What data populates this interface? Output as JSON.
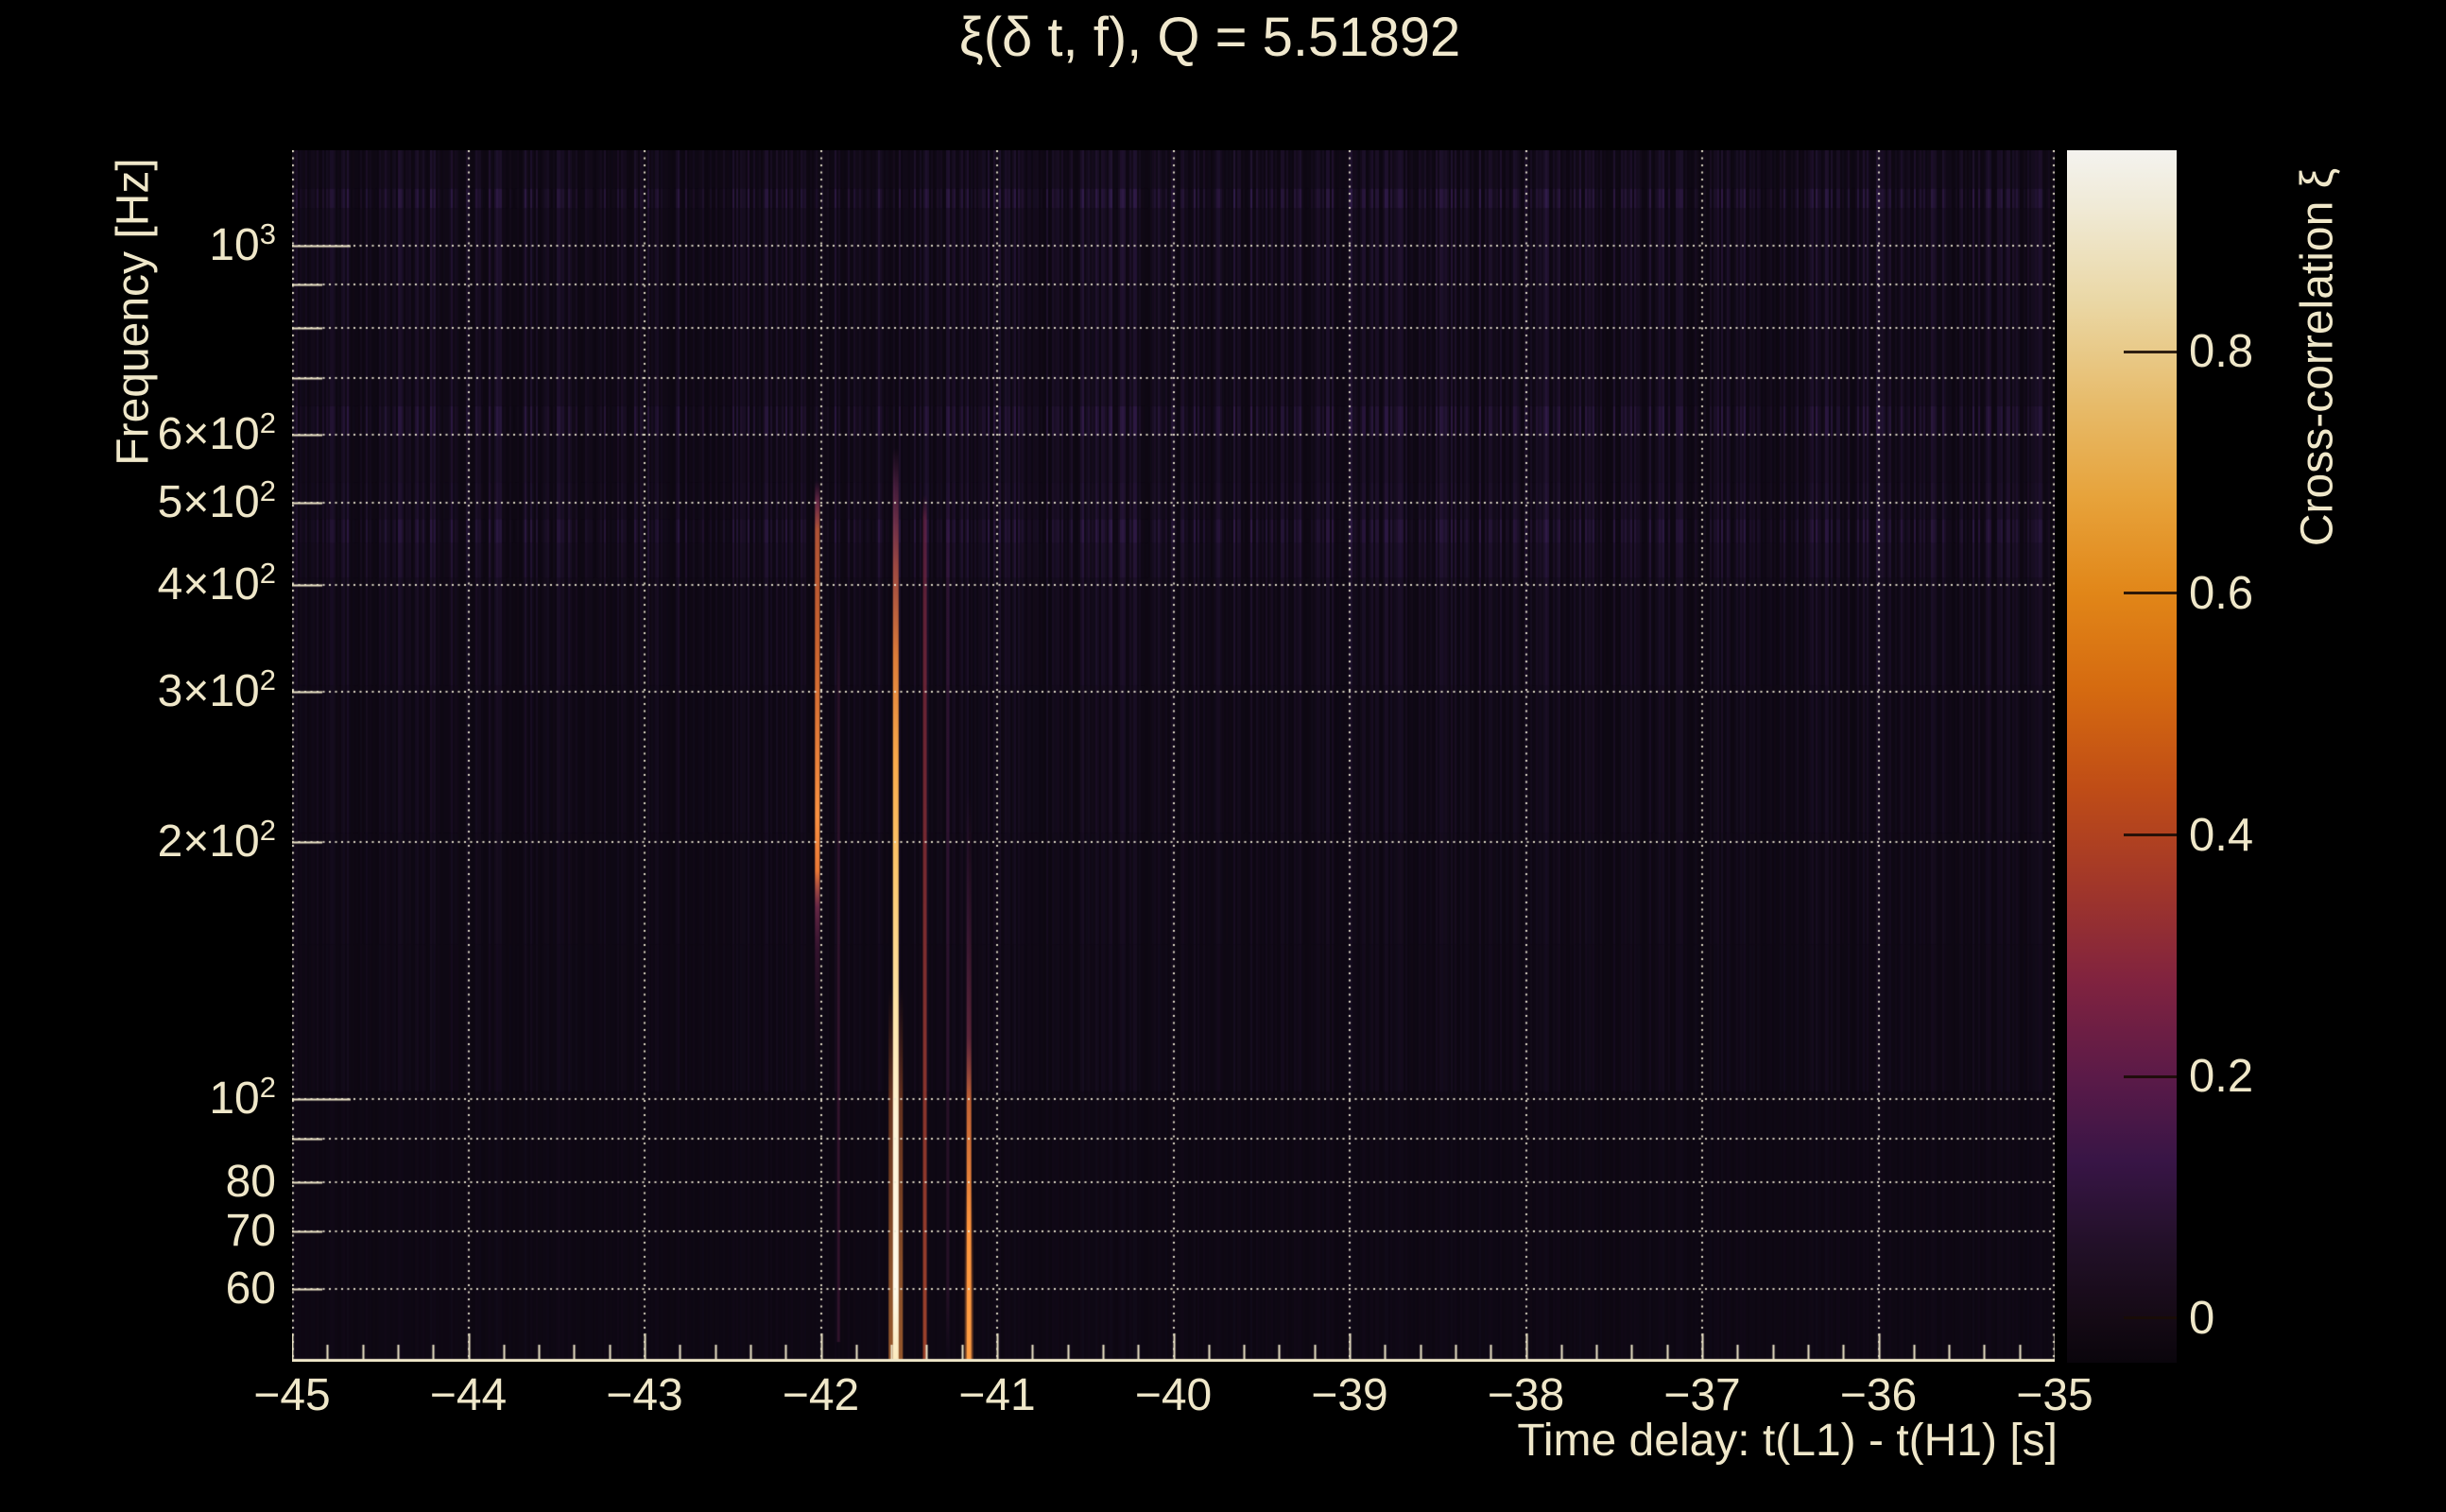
{
  "page": {
    "background": "#000000"
  },
  "chart_data": {
    "type": "heatmap",
    "title": "ξ(δ t, f), Q = 5.51892",
    "xlabel": "Time delay: t(L1) - t(H1) [s]",
    "ylabel": "Frequency [Hz]",
    "grid": true,
    "x_axis": {
      "min": -45,
      "max": -35,
      "minor_step": 0.2,
      "ticks": [
        {
          "t": -45,
          "label": "−45"
        },
        {
          "t": -44,
          "label": "−44"
        },
        {
          "t": -43,
          "label": "−43"
        },
        {
          "t": -42,
          "label": "−42"
        },
        {
          "t": -41,
          "label": "−41"
        },
        {
          "t": -40,
          "label": "−40"
        },
        {
          "t": -39,
          "label": "−39"
        },
        {
          "t": -38,
          "label": "−38"
        },
        {
          "t": -37,
          "label": "−37"
        },
        {
          "t": -36,
          "label": "−36"
        },
        {
          "t": -35,
          "label": "−35"
        }
      ]
    },
    "y_axis": {
      "scale": "log",
      "min": 49.3,
      "max": 1292,
      "gridlines": [
        60,
        70,
        80,
        90,
        100,
        200,
        300,
        400,
        500,
        600,
        700,
        800,
        900,
        1000
      ],
      "decades": [
        100,
        1000
      ],
      "tick_labels": [
        {
          "f": 1000,
          "base": "10",
          "exp": "3"
        },
        {
          "f": 600,
          "base": "6×10",
          "exp": "2"
        },
        {
          "f": 500,
          "base": "5×10",
          "exp": "2"
        },
        {
          "f": 400,
          "base": "4×10",
          "exp": "2"
        },
        {
          "f": 300,
          "base": "3×10",
          "exp": "2"
        },
        {
          "f": 200,
          "base": "2×10",
          "exp": "2"
        },
        {
          "f": 100,
          "base": "10",
          "exp": "2"
        },
        {
          "f": 80,
          "base": "80",
          "exp": ""
        },
        {
          "f": 70,
          "base": "70",
          "exp": ""
        },
        {
          "f": 60,
          "base": "60",
          "exp": ""
        }
      ]
    },
    "colorbar": {
      "title": "Cross-correlation ξ",
      "vmin": -0.037,
      "vmax": 0.967,
      "ticks": [
        {
          "v": 0.0,
          "label": "0"
        },
        {
          "v": 0.2,
          "label": "0.2"
        },
        {
          "v": 0.4,
          "label": "0.4"
        },
        {
          "v": 0.6,
          "label": "0.6"
        },
        {
          "v": 0.8,
          "label": "0.8"
        }
      ],
      "stops": [
        {
          "v": -0.037,
          "c": "#0a050c"
        },
        {
          "v": 0.0,
          "c": "#150a15"
        },
        {
          "v": 0.06,
          "c": "#221028"
        },
        {
          "v": 0.13,
          "c": "#381546"
        },
        {
          "v": 0.2,
          "c": "#5b1a48"
        },
        {
          "v": 0.28,
          "c": "#81233f"
        },
        {
          "v": 0.36,
          "c": "#a23729"
        },
        {
          "v": 0.44,
          "c": "#c04d16"
        },
        {
          "v": 0.52,
          "c": "#d56a10"
        },
        {
          "v": 0.6,
          "c": "#e18618"
        },
        {
          "v": 0.68,
          "c": "#e7a33b"
        },
        {
          "v": 0.76,
          "c": "#e7bc6c"
        },
        {
          "v": 0.84,
          "c": "#ead7a4"
        },
        {
          "v": 0.92,
          "c": "#f0ead6"
        },
        {
          "v": 0.967,
          "c": "#f4f3ef"
        }
      ]
    },
    "background": {
      "base": "#0e0813",
      "noise_rgb": [
        52,
        29,
        78
      ],
      "noise_seed": 11,
      "bands": [
        [
          1292,
          1165,
          0.5
        ],
        [
          1165,
          1105,
          0.95
        ],
        [
          1105,
          1000,
          0.55
        ],
        [
          1000,
          905,
          0.6
        ],
        [
          905,
          805,
          0.5
        ],
        [
          805,
          705,
          0.45
        ],
        [
          705,
          648,
          0.55
        ],
        [
          648,
          598,
          0.9
        ],
        [
          598,
          528,
          0.5
        ],
        [
          528,
          478,
          0.6
        ],
        [
          478,
          448,
          0.9
        ],
        [
          448,
          408,
          0.65
        ],
        [
          408,
          305,
          0.42
        ],
        [
          305,
          205,
          0.32
        ],
        [
          205,
          152,
          0.26
        ],
        [
          152,
          102,
          0.22
        ],
        [
          102,
          49.3,
          0.1
        ]
      ]
    },
    "streaks": [
      {
        "t": -42.02,
        "w": 5,
        "stops": [
          [
            530,
            "rgba(170,55,110,0)"
          ],
          [
            500,
            "rgba(185,70,110,0.5)"
          ],
          [
            465,
            "rgba(225,105,60,0.75)"
          ],
          [
            340,
            "rgba(235,115,50,0.85)"
          ],
          [
            215,
            "rgba(250,145,65,1)"
          ],
          [
            185,
            "rgba(245,125,55,0.95)"
          ],
          [
            168,
            "rgba(160,60,100,0.6)"
          ],
          [
            150,
            "rgba(105,35,80,0.4)"
          ],
          [
            125,
            "rgba(70,25,60,0.2)"
          ],
          [
            105,
            "rgba(70,25,60,0)"
          ]
        ]
      },
      {
        "t": -41.9,
        "w": 3,
        "stops": [
          [
            420,
            "rgba(125,45,95,0)"
          ],
          [
            300,
            "rgba(125,45,95,0.22)"
          ],
          [
            100,
            "rgba(135,50,100,0.3)"
          ],
          [
            52,
            "rgba(135,50,100,0.28)"
          ]
        ]
      },
      {
        "t": -41.575,
        "w": 15,
        "stops": [
          [
            135,
            "rgba(215,95,40,0)"
          ],
          [
            100,
            "rgba(225,110,45,0.4)"
          ],
          [
            62,
            "rgba(240,140,60,0.55)"
          ],
          [
            49.4,
            "rgba(240,140,60,0.6)"
          ]
        ]
      },
      {
        "t": -41.575,
        "w": 6,
        "stops": [
          [
            580,
            "rgba(140,55,115,0)"
          ],
          [
            520,
            "rgba(150,60,115,0.4)"
          ],
          [
            470,
            "rgba(175,75,105,0.6)"
          ],
          [
            420,
            "rgba(205,95,80,0.75)"
          ],
          [
            330,
            "rgba(240,135,60,0.92)"
          ],
          [
            250,
            "rgba(250,170,75,1)"
          ],
          [
            185,
            "rgba(253,200,110,1)"
          ],
          [
            130,
            "rgba(255,228,165,1)"
          ],
          [
            95,
            "rgba(255,244,215,1)"
          ],
          [
            60,
            "rgba(255,250,235,1)"
          ],
          [
            49.4,
            "rgba(252,235,190,1)"
          ]
        ]
      },
      {
        "t": -41.41,
        "w": 4,
        "stops": [
          [
            510,
            "rgba(150,45,85,0)"
          ],
          [
            480,
            "rgba(155,48,88,0.42)"
          ],
          [
            380,
            "rgba(168,52,78,0.5)"
          ],
          [
            260,
            "rgba(182,58,68,0.55)"
          ],
          [
            150,
            "rgba(196,68,60,0.6)"
          ],
          [
            85,
            "rgba(208,80,55,0.65)"
          ],
          [
            49.4,
            "rgba(215,90,52,0.7)"
          ]
        ]
      },
      {
        "t": -41.28,
        "w": 3,
        "stops": [
          [
            520,
            "rgba(120,40,95,0)"
          ],
          [
            420,
            "rgba(120,40,95,0.2)"
          ],
          [
            200,
            "rgba(120,40,95,0.25)"
          ],
          [
            60,
            "rgba(125,45,98,0.2)"
          ],
          [
            50,
            "rgba(125,45,98,0)"
          ]
        ]
      },
      {
        "t": -41.16,
        "w": 9,
        "stops": [
          [
            80,
            "rgba(220,110,45,0)"
          ],
          [
            60,
            "rgba(235,130,55,0.35)"
          ],
          [
            49.4,
            "rgba(238,135,58,0.45)"
          ]
        ]
      },
      {
        "t": -41.16,
        "w": 5,
        "stops": [
          [
            230,
            "rgba(120,40,90,0)"
          ],
          [
            160,
            "rgba(130,48,95,0.3)"
          ],
          [
            118,
            "rgba(165,65,90,0.5)"
          ],
          [
            100,
            "rgba(225,115,60,0.85)"
          ],
          [
            70,
            "rgba(255,150,62,1)"
          ],
          [
            49.4,
            "rgba(255,158,68,1)"
          ]
        ]
      }
    ],
    "frame_color": "#efe7c9",
    "grid_color": "rgba(240,234,212,0.92)",
    "tick_color": "#efe7c9"
  }
}
